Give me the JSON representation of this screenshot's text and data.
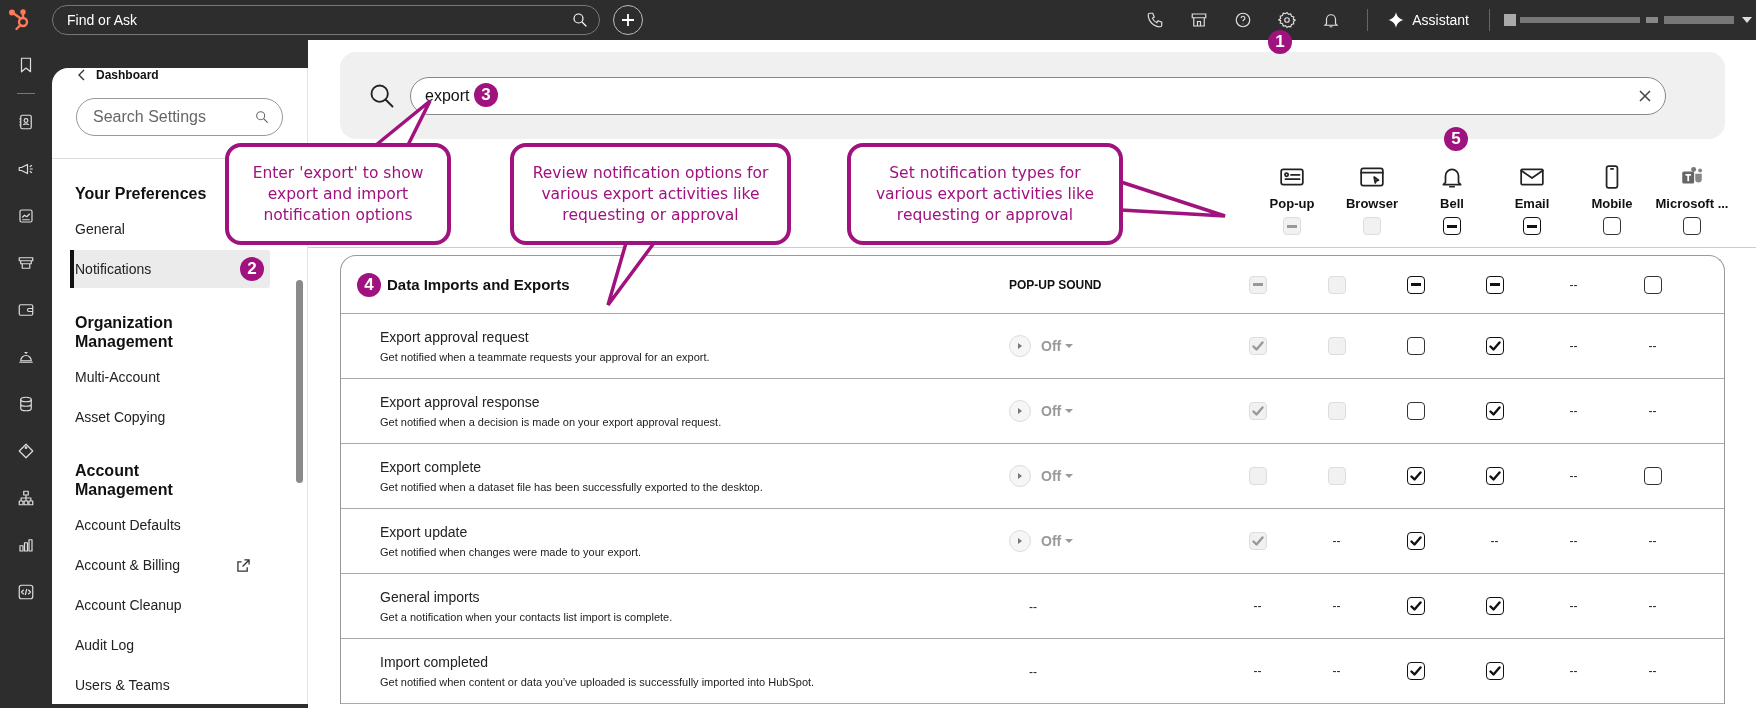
{
  "top_bar": {
    "search": {
      "placeholder": "Find or Ask"
    },
    "assistant": "Assistant"
  },
  "settings_nav": {
    "back": "Dashboard",
    "search": {
      "placeholder": "Search Settings"
    },
    "sections": [
      {
        "title": "Your Preferences",
        "items": [
          {
            "label": "General",
            "selected": false,
            "external": false
          },
          {
            "label": "Notifications",
            "selected": true,
            "external": false
          }
        ]
      },
      {
        "title": "Organization Management",
        "items": [
          {
            "label": "Multi-Account",
            "selected": false,
            "external": false
          },
          {
            "label": "Asset Copying",
            "selected": false,
            "external": false
          }
        ]
      },
      {
        "title": "Account Management",
        "items": [
          {
            "label": "Account Defaults",
            "selected": false,
            "external": false
          },
          {
            "label": "Account & Billing",
            "selected": false,
            "external": true
          },
          {
            "label": "Account Cleanup",
            "selected": false,
            "external": false
          },
          {
            "label": "Audit Log",
            "selected": false,
            "external": false
          },
          {
            "label": "Users & Teams",
            "selected": false,
            "external": false
          }
        ]
      }
    ]
  },
  "search": {
    "value": "export"
  },
  "channels": [
    {
      "label": "Pop-up",
      "cell": {
        "kind": "checkbox",
        "checked": true,
        "mixed": true,
        "disabled": true
      }
    },
    {
      "label": "Browser",
      "cell": {
        "kind": "checkbox",
        "checked": false,
        "mixed": false,
        "disabled": true
      }
    },
    {
      "label": "Bell",
      "cell": {
        "kind": "checkbox",
        "checked": true,
        "mixed": true,
        "disabled": false
      }
    },
    {
      "label": "Email",
      "cell": {
        "kind": "checkbox",
        "checked": true,
        "mixed": true,
        "disabled": false
      }
    },
    {
      "label": "Mobile",
      "cell": {
        "kind": "checkbox",
        "checked": false,
        "mixed": false,
        "disabled": false
      }
    },
    {
      "label": "Microsoft ...",
      "cell": {
        "kind": "checkbox",
        "checked": false,
        "mixed": false,
        "disabled": false
      }
    }
  ],
  "group": {
    "title": "Data Imports and Exports",
    "sound_heading": "POP-UP SOUND",
    "cells": [
      {
        "kind": "checkbox",
        "checked": true,
        "mixed": true,
        "disabled": true
      },
      {
        "kind": "checkbox",
        "checked": false,
        "mixed": false,
        "disabled": true
      },
      {
        "kind": "checkbox",
        "checked": true,
        "mixed": true,
        "disabled": false
      },
      {
        "kind": "checkbox",
        "checked": true,
        "mixed": true,
        "disabled": false
      },
      {
        "kind": "text",
        "text": "--"
      },
      {
        "kind": "checkbox",
        "checked": false,
        "mixed": false,
        "disabled": false
      }
    ]
  },
  "rows": [
    {
      "title": "Export approval request",
      "description": "Get notified when a teammate requests your approval for an export.",
      "sound": {
        "kind": "selector",
        "value": "Off"
      },
      "cells": [
        {
          "kind": "checkbox",
          "checked": true,
          "mixed": false,
          "disabled": true
        },
        {
          "kind": "checkbox",
          "checked": false,
          "mixed": false,
          "disabled": true
        },
        {
          "kind": "checkbox",
          "checked": false,
          "mixed": false,
          "disabled": false
        },
        {
          "kind": "checkbox",
          "checked": true,
          "mixed": false,
          "disabled": false
        },
        {
          "kind": "text",
          "text": "--"
        },
        {
          "kind": "text",
          "text": "--"
        }
      ]
    },
    {
      "title": "Export approval response",
      "description": "Get notified when a decision is made on your export approval request.",
      "sound": {
        "kind": "selector",
        "value": "Off"
      },
      "cells": [
        {
          "kind": "checkbox",
          "checked": true,
          "mixed": false,
          "disabled": true
        },
        {
          "kind": "checkbox",
          "checked": false,
          "mixed": false,
          "disabled": true
        },
        {
          "kind": "checkbox",
          "checked": false,
          "mixed": false,
          "disabled": false
        },
        {
          "kind": "checkbox",
          "checked": true,
          "mixed": false,
          "disabled": false
        },
        {
          "kind": "text",
          "text": "--"
        },
        {
          "kind": "text",
          "text": "--"
        }
      ]
    },
    {
      "title": "Export complete",
      "description": "Get notified when a dataset file has been successfully exported to the desktop.",
      "sound": {
        "kind": "selector",
        "value": "Off"
      },
      "cells": [
        {
          "kind": "checkbox",
          "checked": false,
          "mixed": false,
          "disabled": true
        },
        {
          "kind": "checkbox",
          "checked": false,
          "mixed": false,
          "disabled": true
        },
        {
          "kind": "checkbox",
          "checked": true,
          "mixed": false,
          "disabled": false
        },
        {
          "kind": "checkbox",
          "checked": true,
          "mixed": false,
          "disabled": false
        },
        {
          "kind": "text",
          "text": "--"
        },
        {
          "kind": "checkbox",
          "checked": false,
          "mixed": false,
          "disabled": false
        }
      ]
    },
    {
      "title": "Export update",
      "description": "Get notified when changes were made to your export.",
      "sound": {
        "kind": "selector",
        "value": "Off"
      },
      "cells": [
        {
          "kind": "checkbox",
          "checked": true,
          "mixed": false,
          "disabled": true
        },
        {
          "kind": "text",
          "text": "--"
        },
        {
          "kind": "checkbox",
          "checked": true,
          "mixed": false,
          "disabled": false
        },
        {
          "kind": "text",
          "text": "--"
        },
        {
          "kind": "text",
          "text": "--"
        },
        {
          "kind": "text",
          "text": "--"
        }
      ]
    },
    {
      "title": "General imports",
      "description": "Get a notification when your contacts list import is complete.",
      "sound": {
        "kind": "text",
        "text": "--"
      },
      "cells": [
        {
          "kind": "text",
          "text": "--"
        },
        {
          "kind": "text",
          "text": "--"
        },
        {
          "kind": "checkbox",
          "checked": true,
          "mixed": false,
          "disabled": false
        },
        {
          "kind": "checkbox",
          "checked": true,
          "mixed": false,
          "disabled": false
        },
        {
          "kind": "text",
          "text": "--"
        },
        {
          "kind": "text",
          "text": "--"
        }
      ]
    },
    {
      "title": "Import completed",
      "description": "Get notified when content or data you’ve uploaded is successfully imported into HubSpot.",
      "sound": {
        "kind": "text",
        "text": "--"
      },
      "cells": [
        {
          "kind": "text",
          "text": "--"
        },
        {
          "kind": "text",
          "text": "--"
        },
        {
          "kind": "checkbox",
          "checked": true,
          "mixed": false,
          "disabled": false
        },
        {
          "kind": "checkbox",
          "checked": true,
          "mixed": false,
          "disabled": false
        },
        {
          "kind": "text",
          "text": "--"
        },
        {
          "kind": "text",
          "text": "--"
        }
      ]
    }
  ],
  "annotations": {
    "callouts": [
      {
        "text": "Enter 'export' to show export and import notification options"
      },
      {
        "text": "Review notification options for various export activities like requesting or approval"
      },
      {
        "text": "Set notification types for various export activities like requesting or approval"
      }
    ],
    "badges": [
      "1",
      "2",
      "3",
      "4",
      "5"
    ]
  }
}
